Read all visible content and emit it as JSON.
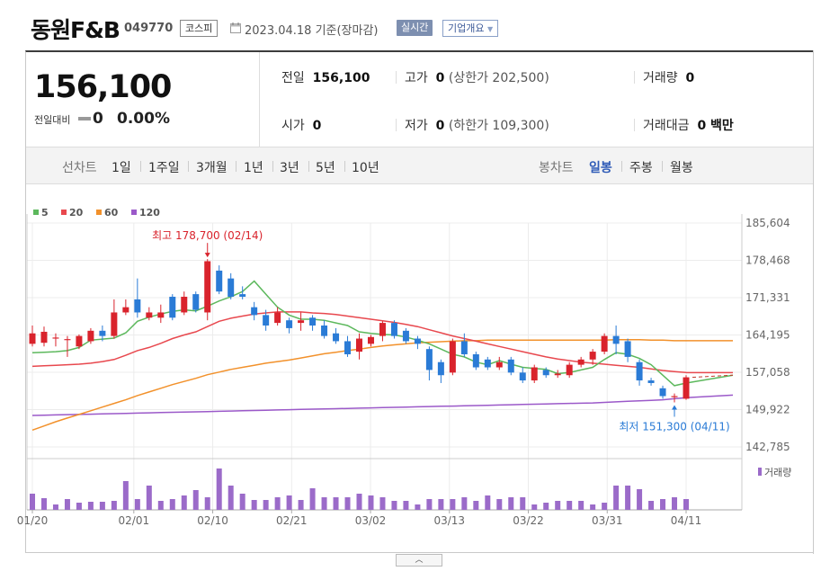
{
  "header": {
    "stock_name": "동원F&B",
    "stock_code": "049770",
    "market_tag": "코스피",
    "date_text": "2023.04.18 기준(장마감)",
    "realtime_button": "실시간",
    "company_button": "기업개요"
  },
  "price": {
    "current": "156,100",
    "change_label": "전일대비",
    "change": "0",
    "change_pct": "0.00%"
  },
  "stats": {
    "prev_label": "전일",
    "prev_value": "156,100",
    "high_label": "고가",
    "high_value": "0",
    "upper_limit": "(상한가 202,500)",
    "volume_label": "거래량",
    "volume_value": "0",
    "open_label": "시가",
    "open_value": "0",
    "low_label": "저가",
    "low_value": "0",
    "lower_limit": "(하한가 109,300)",
    "amount_label": "거래대금",
    "amount_value": "0 백만"
  },
  "period": {
    "line_label": "선차트",
    "line_items": [
      "1일",
      "1주일",
      "3개월",
      "1년",
      "3년",
      "5년",
      "10년"
    ],
    "candle_label": "봉차트",
    "candle_items": [
      "일봉",
      "주봉",
      "월봉"
    ],
    "candle_active": "일봉"
  },
  "chart_data": {
    "type": "candlestick",
    "ma_legend": [
      {
        "name": "5",
        "color": "#5cb85c"
      },
      {
        "name": "20",
        "color": "#e8484e"
      },
      {
        "name": "60",
        "color": "#f2912b"
      },
      {
        "name": "120",
        "color": "#9b59c9"
      }
    ],
    "y_ticks": [
      "185,604",
      "178,468",
      "171,331",
      "164,195",
      "157,058",
      "149,922",
      "142,785"
    ],
    "ylim": [
      142785,
      185604
    ],
    "x_ticks": [
      "01/20",
      "02/01",
      "02/10",
      "02/21",
      "03/02",
      "03/13",
      "03/22",
      "03/31",
      "04/11"
    ],
    "annotations": {
      "high": "최고 178,700 (02/14)",
      "low": "최저 151,300 (04/11)"
    },
    "volume_label": "거래량",
    "up_color": "#d9232c",
    "down_color": "#2a7bd6",
    "candles": [
      {
        "o": 162500,
        "c": 164500,
        "h": 166000,
        "l": 162000
      },
      {
        "o": 162700,
        "c": 164800,
        "h": 165800,
        "l": 162000
      },
      {
        "o": 163500,
        "c": 163700,
        "h": 164500,
        "l": 162000
      },
      {
        "o": 163200,
        "c": 163400,
        "h": 164000,
        "l": 160000
      },
      {
        "o": 162000,
        "c": 164000,
        "h": 164300,
        "l": 161500
      },
      {
        "o": 163000,
        "c": 165000,
        "h": 165500,
        "l": 162500
      },
      {
        "o": 165000,
        "c": 164000,
        "h": 166000,
        "l": 163000
      },
      {
        "o": 164000,
        "c": 168500,
        "h": 171000,
        "l": 163500
      },
      {
        "o": 168500,
        "c": 169500,
        "h": 171000,
        "l": 168000
      },
      {
        "o": 171000,
        "c": 168500,
        "h": 175000,
        "l": 167500
      },
      {
        "o": 167500,
        "c": 168500,
        "h": 169500,
        "l": 167000
      },
      {
        "o": 167500,
        "c": 168500,
        "h": 170000,
        "l": 166500
      },
      {
        "o": 171500,
        "c": 167500,
        "h": 172000,
        "l": 167000
      },
      {
        "o": 168500,
        "c": 171500,
        "h": 172500,
        "l": 168000
      },
      {
        "o": 172000,
        "c": 169000,
        "h": 172500,
        "l": 168500
      },
      {
        "o": 168500,
        "c": 178300,
        "h": 178700,
        "l": 167000
      },
      {
        "o": 176500,
        "c": 172500,
        "h": 177500,
        "l": 172000
      },
      {
        "o": 175000,
        "c": 171500,
        "h": 176000,
        "l": 171000
      },
      {
        "o": 172000,
        "c": 171500,
        "h": 173500,
        "l": 171000
      },
      {
        "o": 169500,
        "c": 168000,
        "h": 170500,
        "l": 167000
      },
      {
        "o": 168000,
        "c": 166000,
        "h": 169000,
        "l": 165000
      },
      {
        "o": 166500,
        "c": 168500,
        "h": 169500,
        "l": 166000
      },
      {
        "o": 167000,
        "c": 165500,
        "h": 167500,
        "l": 164500
      },
      {
        "o": 166500,
        "c": 167000,
        "h": 168500,
        "l": 165000
      },
      {
        "o": 167500,
        "c": 166000,
        "h": 168000,
        "l": 165000
      },
      {
        "o": 166000,
        "c": 164000,
        "h": 167000,
        "l": 163500
      },
      {
        "o": 164500,
        "c": 163000,
        "h": 165500,
        "l": 162500
      },
      {
        "o": 163000,
        "c": 160500,
        "h": 164000,
        "l": 160000
      },
      {
        "o": 161000,
        "c": 163500,
        "h": 164500,
        "l": 159500
      },
      {
        "o": 162500,
        "c": 163800,
        "h": 164200,
        "l": 162000
      },
      {
        "o": 164000,
        "c": 166500,
        "h": 166800,
        "l": 163000
      },
      {
        "o": 166500,
        "c": 164000,
        "h": 167000,
        "l": 163500
      },
      {
        "o": 165000,
        "c": 163000,
        "h": 165500,
        "l": 162500
      },
      {
        "o": 163500,
        "c": 162500,
        "h": 164000,
        "l": 161500
      },
      {
        "o": 161500,
        "c": 157500,
        "h": 162000,
        "l": 155500
      },
      {
        "o": 159000,
        "c": 156500,
        "h": 159500,
        "l": 155000
      },
      {
        "o": 157000,
        "c": 163000,
        "h": 163500,
        "l": 156500
      },
      {
        "o": 163000,
        "c": 160500,
        "h": 164500,
        "l": 160000
      },
      {
        "o": 160500,
        "c": 158000,
        "h": 161000,
        "l": 157500
      },
      {
        "o": 159500,
        "c": 158000,
        "h": 160000,
        "l": 157500
      },
      {
        "o": 158000,
        "c": 159000,
        "h": 160000,
        "l": 157500
      },
      {
        "o": 159500,
        "c": 157000,
        "h": 160000,
        "l": 156500
      },
      {
        "o": 157000,
        "c": 155500,
        "h": 158000,
        "l": 155000
      },
      {
        "o": 155500,
        "c": 158000,
        "h": 158500,
        "l": 155000
      },
      {
        "o": 157500,
        "c": 156500,
        "h": 158000,
        "l": 156000
      },
      {
        "o": 156500,
        "c": 156800,
        "h": 157500,
        "l": 156000
      },
      {
        "o": 156500,
        "c": 158500,
        "h": 159000,
        "l": 156000
      },
      {
        "o": 158500,
        "c": 159500,
        "h": 160000,
        "l": 158000
      },
      {
        "o": 159500,
        "c": 161000,
        "h": 161500,
        "l": 158500
      },
      {
        "o": 161000,
        "c": 164000,
        "h": 164500,
        "l": 160500
      },
      {
        "o": 164000,
        "c": 162500,
        "h": 166000,
        "l": 160500
      },
      {
        "o": 163000,
        "c": 160000,
        "h": 163500,
        "l": 159000
      },
      {
        "o": 159000,
        "c": 155500,
        "h": 159500,
        "l": 154500
      },
      {
        "o": 155500,
        "c": 155000,
        "h": 156000,
        "l": 154500
      },
      {
        "o": 154000,
        "c": 152500,
        "h": 154500,
        "l": 152000
      },
      {
        "o": 152300,
        "c": 152500,
        "h": 153000,
        "l": 151300
      },
      {
        "o": 152000,
        "c": 156100,
        "h": 156500,
        "l": 151800
      }
    ],
    "ma5": [
      160800,
      160900,
      161000,
      161200,
      161800,
      163200,
      163400,
      163600,
      164600,
      166800,
      167600,
      168200,
      168700,
      169000,
      168800,
      169700,
      170700,
      171500,
      172500,
      174500,
      172000,
      169500,
      168000,
      167200,
      167200,
      167000,
      166500,
      166000,
      164800,
      164500,
      164300,
      164200,
      163800,
      163200,
      162500,
      161500,
      160500,
      160000,
      159000,
      158500,
      159300,
      158600,
      158000,
      157800,
      157600,
      156800,
      157000,
      157500,
      158000,
      159500,
      160800,
      160500,
      159700,
      158500,
      156500,
      154500,
      155000
    ],
    "ma20": [
      158200,
      158300,
      158400,
      158500,
      158600,
      158800,
      159100,
      159500,
      160300,
      161200,
      161800,
      162600,
      163500,
      164200,
      164800,
      165800,
      166800,
      167400,
      167800,
      168200,
      168400,
      168600,
      168600,
      168600,
      168400,
      168300,
      168100,
      167800,
      167500,
      167200,
      166900,
      166600,
      166200,
      165800,
      165200,
      164600,
      164000,
      163500,
      163000,
      162500,
      162000,
      161500,
      161000,
      160500,
      160000,
      159600,
      159300,
      159000,
      158800,
      158600,
      158400,
      158200,
      158000,
      157700,
      157400,
      157200,
      157000
    ],
    "ma60": [
      146000,
      146800,
      147600,
      148300,
      149000,
      149700,
      150400,
      151100,
      151800,
      152600,
      153300,
      154000,
      154700,
      155300,
      155900,
      156600,
      157100,
      157600,
      158000,
      158400,
      158800,
      159100,
      159400,
      159800,
      160200,
      160600,
      160900,
      161200,
      161500,
      161800,
      162100,
      162300,
      162500,
      162700,
      162800,
      162900,
      163000,
      163100,
      163100,
      163200,
      163200,
      163200,
      163200,
      163200,
      163200,
      163200,
      163200,
      163200,
      163200,
      163200,
      163300,
      163300,
      163300,
      163200,
      163200,
      163100,
      163100
    ],
    "ma120": [
      148800,
      148850,
      148900,
      148950,
      149000,
      149050,
      149100,
      149150,
      149200,
      149250,
      149300,
      149350,
      149400,
      149450,
      149500,
      149550,
      149600,
      149650,
      149700,
      149750,
      149800,
      149850,
      149900,
      149950,
      150000,
      150050,
      150100,
      150150,
      150200,
      150250,
      150300,
      150350,
      150400,
      150450,
      150500,
      150550,
      150600,
      150650,
      150700,
      150750,
      150800,
      150850,
      150900,
      150950,
      151000,
      151050,
      151100,
      151150,
      151200,
      151300,
      151400,
      151500,
      151600,
      151700,
      151800,
      152000,
      152200
    ],
    "volumes": [
      18,
      13,
      6,
      12,
      8,
      9,
      9,
      10,
      32,
      12,
      27,
      10,
      12,
      16,
      22,
      14,
      46,
      27,
      18,
      11,
      11,
      14,
      16,
      11,
      24,
      14,
      14,
      14,
      18,
      16,
      14,
      10,
      10,
      6,
      12,
      12,
      12,
      14,
      10,
      16,
      12,
      14,
      14,
      6,
      8,
      10,
      10,
      10,
      6,
      8,
      27,
      27,
      23,
      10,
      12,
      14,
      12
    ]
  }
}
